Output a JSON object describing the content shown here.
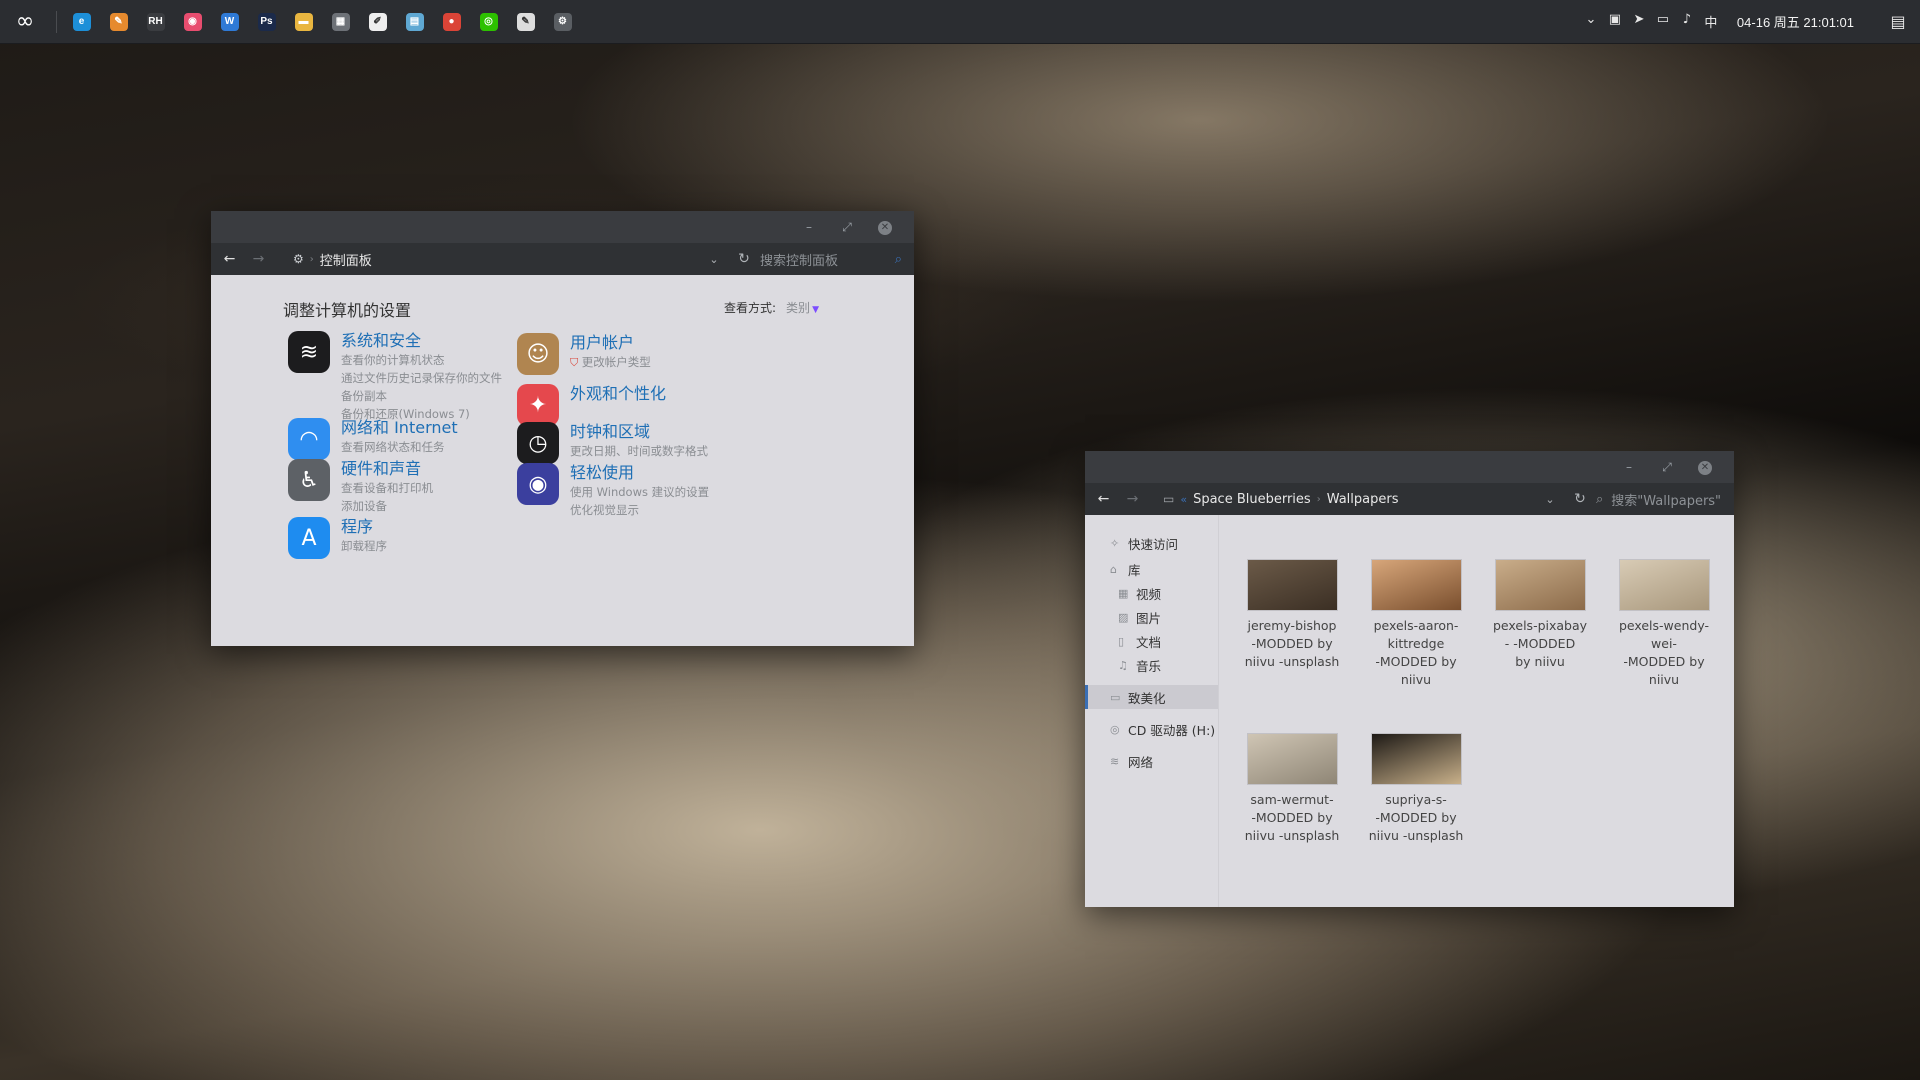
{
  "taskbar": {
    "start_glyph": "∞",
    "apps": [
      {
        "name": "edge",
        "glyph": "e",
        "color": "#1d8fd8"
      },
      {
        "name": "tools",
        "glyph": "✎",
        "color": "#e68a2e"
      },
      {
        "name": "rh",
        "glyph": "RH",
        "color": "#3a3c40"
      },
      {
        "name": "camera",
        "glyph": "◉",
        "color": "#e84d6f"
      },
      {
        "name": "word",
        "glyph": "W",
        "color": "#2f7ad6"
      },
      {
        "name": "photoshop",
        "glyph": "Ps",
        "color": "#1b2a4a"
      },
      {
        "name": "folder",
        "glyph": "▬",
        "color": "#e9b640"
      },
      {
        "name": "calculator",
        "glyph": "▦",
        "color": "#6d7177"
      },
      {
        "name": "notes",
        "glyph": "✐",
        "color": "#eeeeee"
      },
      {
        "name": "sheet",
        "glyph": "▤",
        "color": "#5fa8d3"
      },
      {
        "name": "chrome",
        "glyph": "●",
        "color": "#db4437"
      },
      {
        "name": "wechat",
        "glyph": "◎",
        "color": "#2dc100"
      },
      {
        "name": "editor",
        "glyph": "✎",
        "color": "#dddddd"
      },
      {
        "name": "settings",
        "glyph": "⚙",
        "color": "#5a5e63"
      }
    ],
    "tray_icons": [
      "⌄",
      "▣",
      "➤",
      "▭",
      "♪",
      "中"
    ],
    "clock": "04-16 周五 21:01:01",
    "notify_glyph": "▤"
  },
  "control_panel": {
    "breadcrumb": "控制面板",
    "search_placeholder": "搜索控制面板",
    "heading": "调整计算机的设置",
    "view_by_label": "查看方式:",
    "view_by_value": "类别",
    "items": [
      {
        "title": "系统和安全",
        "subs": [
          "查看你的计算机状态",
          "通过文件历史记录保存你的文件备份副本",
          "备份和还原(Windows 7)"
        ],
        "icon": "activity-monitor",
        "glyph": "≋",
        "color": "#1c1c1e"
      },
      {
        "title": "网络和 Internet",
        "subs": [
          "查看网络状态和任务"
        ],
        "icon": "wifi",
        "glyph": "◠",
        "color": "#2f8ef0"
      },
      {
        "title": "硬件和声音",
        "subs": [
          "查看设备和打印机",
          "添加设备"
        ],
        "icon": "accessibility",
        "glyph": "♿",
        "color": "#5d6166"
      },
      {
        "title": "程序",
        "subs": [
          "卸载程序"
        ],
        "icon": "app-store",
        "glyph": "A",
        "color": "#1e8cf0"
      },
      {
        "title": "用户帐户",
        "subs": [
          "更改帐户类型"
        ],
        "icon": "contacts",
        "glyph": "☺",
        "color": "#b08550"
      },
      {
        "title": "外观和个性化",
        "subs": [],
        "icon": "color-picker",
        "glyph": "✦",
        "color": "#e5484d"
      },
      {
        "title": "时钟和区域",
        "subs": [
          "更改日期、时间或数字格式"
        ],
        "icon": "clock",
        "glyph": "◷",
        "color": "#1c1c1e"
      },
      {
        "title": "轻松使用",
        "subs": [
          "使用 Windows 建议的设置",
          "优化视觉显示"
        ],
        "icon": "siri",
        "glyph": "◉",
        "color": "#3b3f9e"
      }
    ]
  },
  "explorer": {
    "path": [
      "Space Blueberries",
      "Wallpapers"
    ],
    "search_placeholder": "搜索\"Wallpapers\"",
    "nav": [
      {
        "label": "快速访问",
        "icon": "pin-icon",
        "glyph": "✧",
        "sub": false,
        "active": false,
        "gap": 0
      },
      {
        "label": "库",
        "icon": "home-icon",
        "glyph": "⌂",
        "sub": false,
        "active": false,
        "gap": 2
      },
      {
        "label": "视频",
        "icon": "video-icon",
        "glyph": "▦",
        "sub": true,
        "active": false,
        "gap": 0
      },
      {
        "label": "图片",
        "icon": "picture-icon",
        "glyph": "▨",
        "sub": true,
        "active": false,
        "gap": 0
      },
      {
        "label": "文档",
        "icon": "document-icon",
        "glyph": "▯",
        "sub": true,
        "active": false,
        "gap": 0
      },
      {
        "label": "音乐",
        "icon": "music-icon",
        "glyph": "♫",
        "sub": true,
        "active": false,
        "gap": 0
      },
      {
        "label": "致美化",
        "icon": "computer-icon",
        "glyph": "▭",
        "sub": false,
        "active": true,
        "gap": 8
      },
      {
        "label": "CD 驱动器 (H:)",
        "icon": "disc-icon",
        "glyph": "◎",
        "sub": false,
        "active": false,
        "gap": 8
      },
      {
        "label": "网络",
        "icon": "network-icon",
        "glyph": "≋",
        "sub": false,
        "active": false,
        "gap": 8
      }
    ],
    "files": [
      {
        "name": "jeremy-bishop -MODDED by niivu -unsplash",
        "lines": [
          "jeremy-bishop",
          "-MODDED by",
          "niivu -unsplash"
        ],
        "thumb": [
          "#6b5a48",
          "#3b2f24"
        ]
      },
      {
        "name": "pexels-aaron-kittredge -MODDED by niivu",
        "lines": [
          "pexels-aaron-",
          "kittredge",
          "-MODDED by",
          "niivu"
        ],
        "thumb": [
          "#d7a67a",
          "#7a4f2e"
        ]
      },
      {
        "name": "pexels-pixabay- -MODDED by niivu",
        "lines": [
          "pexels-pixabay",
          "- -MODDED",
          "by niivu"
        ],
        "thumb": [
          "#c9ad8a",
          "#8c6b4a"
        ]
      },
      {
        "name": "pexels-wendy-wei- -MODDED by niivu",
        "lines": [
          "pexels-wendy-",
          "wei-",
          "-MODDED by",
          "niivu"
        ],
        "thumb": [
          "#d8cbb5",
          "#a8977c"
        ]
      },
      {
        "name": "sam-wermut- -MODDED by niivu -unsplash",
        "lines": [
          "sam-wermut-",
          "-MODDED by",
          "niivu -unsplash"
        ],
        "thumb": [
          "#cfc5b4",
          "#8f8676"
        ]
      },
      {
        "name": "supriya-s- -MODDED by niivu -unsplash",
        "lines": [
          "supriya-s-",
          "-MODDED by",
          "niivu -unsplash"
        ],
        "thumb": [
          "#1e1a16",
          "#c8b08a"
        ]
      }
    ]
  }
}
